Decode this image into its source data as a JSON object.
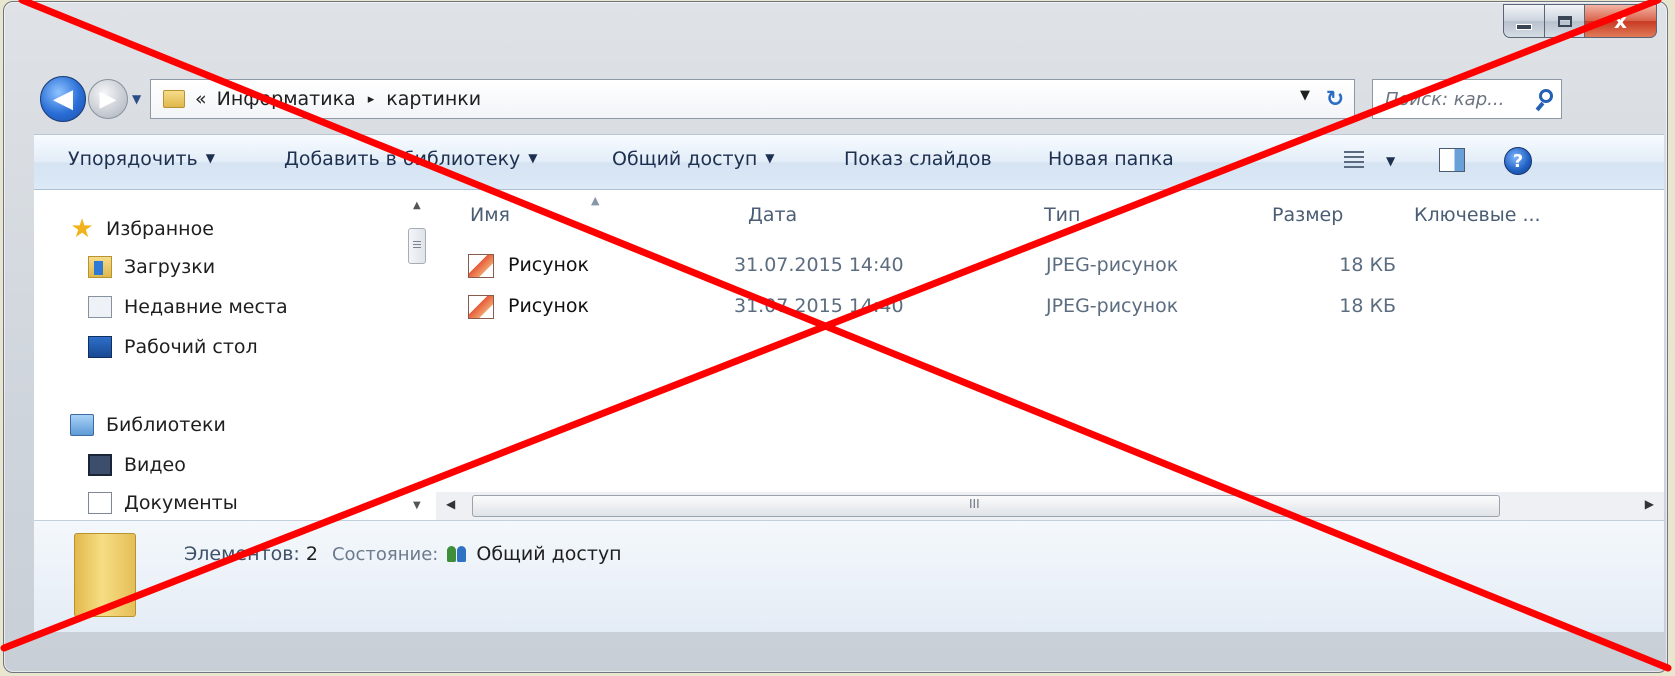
{
  "window": {
    "caption": {
      "minimize": "",
      "maximize": "",
      "close": "x"
    },
    "back_icon": "back-arrow-icon",
    "forward_icon": "forward-arrow-icon"
  },
  "address": {
    "overflow": "«",
    "segments": [
      "Информатика",
      "картинки"
    ],
    "separator": "▸"
  },
  "search": {
    "placeholder": "Поиск: кар..."
  },
  "toolbar": {
    "organize": "Упорядочить",
    "add_to_library": "Добавить в библиотеку",
    "share": "Общий доступ",
    "slideshow": "Показ слайдов",
    "new_folder": "Новая папка",
    "help": "?"
  },
  "navigation": {
    "favorites": "Избранное",
    "downloads": "Загрузки",
    "recent": "Недавние места",
    "desktop": "Рабочий стол",
    "libraries": "Библиотеки",
    "video": "Видео",
    "documents": "Документы"
  },
  "columns": {
    "name": "Имя",
    "date": "Дата",
    "type": "Тип",
    "size": "Размер",
    "keywords": "Ключевые ..."
  },
  "files": [
    {
      "name": "Рисунок",
      "date": "31.07.2015 14:40",
      "type": "JPEG-рисунок",
      "size": "18 КБ"
    },
    {
      "name": "Рисунок",
      "date": "31.07.2015 14:40",
      "type": "JPEG-рисунок",
      "size": "18 КБ"
    }
  ],
  "scroll_grip": "III",
  "details": {
    "count_label": "Элементов:",
    "count": "2",
    "state_label": "Состояние:",
    "share_state": "Общий доступ"
  },
  "colors": {
    "overlay_cross": "#ff0000",
    "toolbar_bg": "#dce9f7",
    "accent": "#2a6ed6"
  }
}
